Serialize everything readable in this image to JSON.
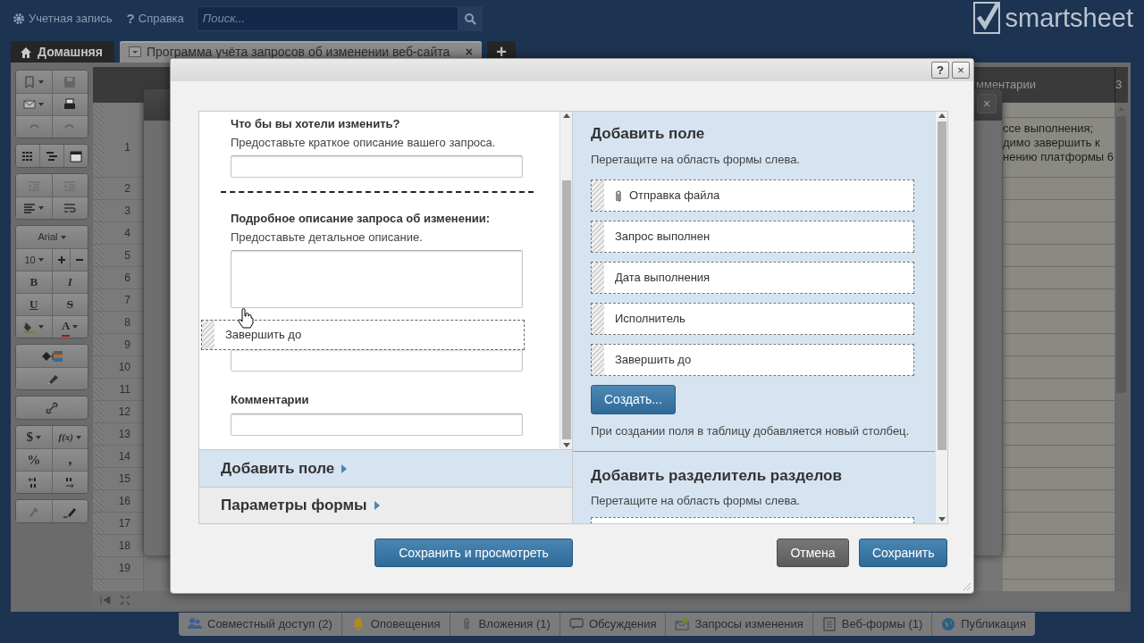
{
  "topbar": {
    "account": "Учетная запись",
    "help_icon": "?",
    "help": "Справка",
    "search": {
      "placeholder": "Поиск..."
    },
    "logo": "smartsheet"
  },
  "tabs": [
    {
      "label": "Домашняя",
      "kind": "home",
      "selected": false
    },
    {
      "label": "Программа учёта запросов об изменении веб-сайта",
      "kind": "sheet",
      "selected": true,
      "close": "×"
    },
    {
      "label": "+",
      "kind": "add",
      "selected": false
    }
  ],
  "toolbar": {
    "font": "Arial",
    "size": "10",
    "bold": "B",
    "italic": "I",
    "underline": "U",
    "strike": "S",
    "text_color": "A",
    "currency": "$",
    "formula": "f(x)",
    "percent": "%",
    "comma": ","
  },
  "grid": {
    "comments_header": "мментарии",
    "column_3": "3",
    "row_numbers": [
      "1",
      "2",
      "3",
      "4",
      "5",
      "6",
      "7",
      "8",
      "9",
      "10",
      "11",
      "12",
      "13",
      "14",
      "15",
      "16",
      "17",
      "18",
      "19"
    ],
    "comment_lines": [
      "ссе выполнения;",
      "димо завершить к",
      "нению платформы 6"
    ]
  },
  "dialog": {
    "help": "?",
    "close": "×",
    "form": [
      {
        "kind": "field",
        "label": "Что бы вы хотели изменить?",
        "hint": "Предоставьте краткое описание вашего запроса.",
        "multiline": false
      },
      {
        "kind": "divider"
      },
      {
        "kind": "field",
        "label": "Подробное описание запроса об изменении:",
        "hint": "Предоставьте детальное описание.",
        "multiline": true
      },
      {
        "kind": "field",
        "multiline": false
      },
      {
        "kind": "field",
        "label": "Комментарии",
        "multiline": false
      }
    ],
    "drag_ghost": "Завершить до",
    "accordion": [
      {
        "label": "Добавить поле",
        "selected": true
      },
      {
        "label": "Параметры формы",
        "selected": false
      }
    ],
    "add_field": {
      "title": "Добавить поле",
      "hint": "Перетащите на область формы слева.",
      "items": [
        {
          "label": "Отправка файла",
          "kind": "attachment"
        },
        {
          "label": "Запрос выполнен",
          "kind": "plain"
        },
        {
          "label": "Дата выполнения",
          "kind": "plain"
        },
        {
          "label": "Исполнитель",
          "kind": "plain"
        },
        {
          "label": "Завершить до",
          "kind": "plain"
        }
      ],
      "create": "Создать...",
      "note": "При создании поля в таблицу добавляется новый столбец."
    },
    "add_divider": {
      "title": "Добавить разделитель разделов",
      "hint": "Перетащите на область формы слева."
    },
    "buttons": [
      {
        "label": "Сохранить и просмотреть",
        "kind": "primary"
      },
      {
        "label": "Отмена",
        "kind": "secondary"
      },
      {
        "label": "Сохранить",
        "kind": "primary"
      }
    ]
  },
  "bottom_tabs": [
    "Совместный доступ (2)",
    "Оповещения",
    "Вложения (1)",
    "Обсуждения",
    "Запросы изменения",
    "Веб-формы (1)",
    "Публикация"
  ]
}
